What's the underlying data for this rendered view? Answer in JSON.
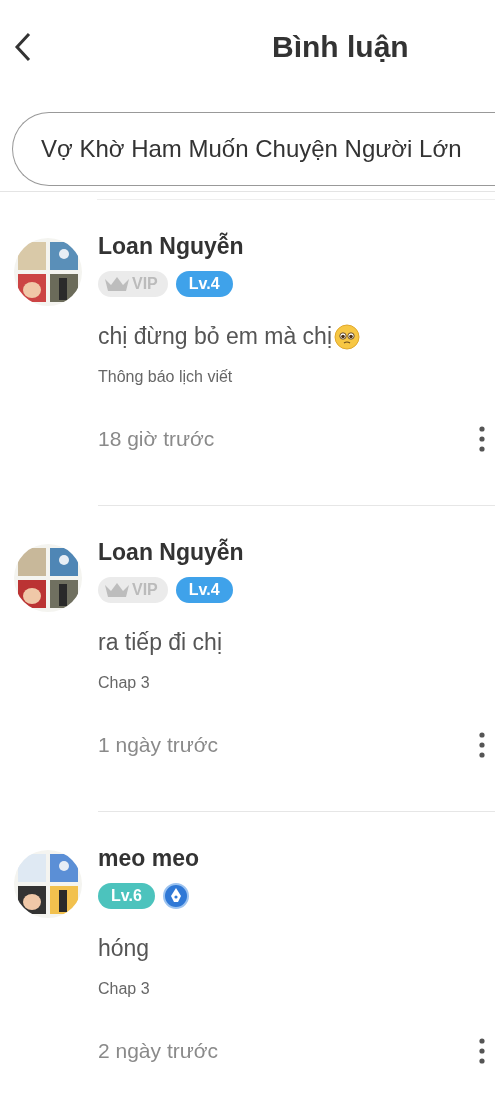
{
  "header": {
    "title": "Bình luận"
  },
  "story_title": "Vợ Khờ Ham Muốn Chuyện Người Lớn",
  "comments": [
    {
      "author": "Loan Nguyễn",
      "avatar": {
        "kind": "picture"
      },
      "badges": [
        {
          "kind": "vip",
          "label": "VIP"
        },
        {
          "kind": "level",
          "label": "Lv.4",
          "color": "#3fa2ea"
        }
      ],
      "text": "chị đừng bỏ em mà chị",
      "emoji": true,
      "chapter": "Thông báo lịch viết",
      "time": "18 giờ trước"
    },
    {
      "author": "Loan Nguyễn",
      "avatar": {
        "kind": "picture"
      },
      "badges": [
        {
          "kind": "vip",
          "label": "VIP"
        },
        {
          "kind": "level",
          "label": "Lv.4",
          "color": "#3fa2ea"
        }
      ],
      "text": "ra tiếp đi chị",
      "emoji": false,
      "chapter": "Chap 3",
      "time": "1 ngày trước"
    },
    {
      "author": "meo meo",
      "avatar": {
        "kind": "picture"
      },
      "badges": [
        {
          "kind": "level",
          "label": "Lv.6",
          "color": "#4cc3bd"
        },
        {
          "kind": "writer"
        }
      ],
      "text": "hóng",
      "emoji": false,
      "chapter": "Chap 3",
      "time": "2 ngày trước"
    }
  ]
}
